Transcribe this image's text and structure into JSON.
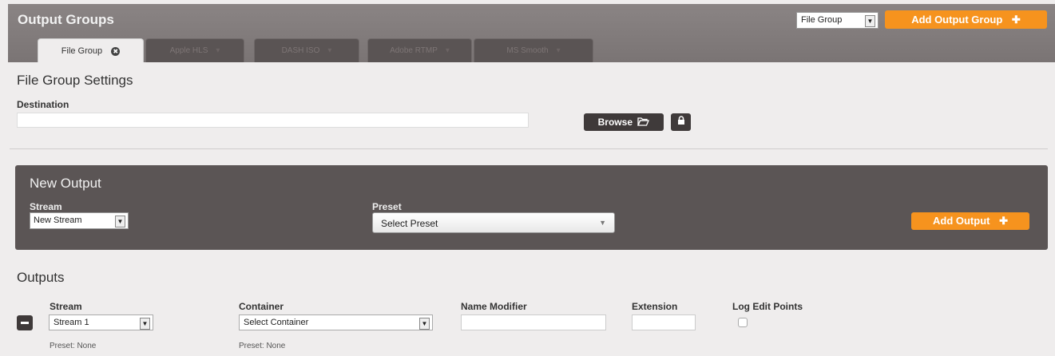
{
  "header": {
    "title": "Output Groups",
    "type_select": "File Group",
    "add_group_label": "Add Output Group",
    "add_group_icon": "✚"
  },
  "tabs": [
    {
      "label": "File Group",
      "active": true
    },
    {
      "label": "Apple HLS",
      "active": false
    },
    {
      "label": "DASH ISO",
      "active": false
    },
    {
      "label": "Adobe RTMP",
      "active": false
    },
    {
      "label": "MS Smooth",
      "active": false
    }
  ],
  "settings": {
    "title": "File Group Settings",
    "destination_label": "Destination",
    "destination_value": "",
    "browse_label": "Browse",
    "browse_icon": "folder-open-icon",
    "lock_icon": "lock-icon"
  },
  "new_output": {
    "title": "New Output",
    "stream_label": "Stream",
    "stream_value": "New Stream",
    "preset_label": "Preset",
    "preset_value": "Select Preset",
    "add_output_label": "Add Output",
    "add_output_icon": "✚"
  },
  "outputs": {
    "title": "Outputs",
    "columns": {
      "stream": "Stream",
      "container": "Container",
      "name_modifier": "Name Modifier",
      "extension": "Extension",
      "log_edit_points": "Log Edit Points"
    },
    "row": {
      "stream_value": "Stream 1",
      "container_value": "Select Container",
      "name_modifier_value": "",
      "extension_value": "",
      "stream_preset_note": "Preset: None",
      "container_preset_note": "Preset: None"
    }
  },
  "colors": {
    "accent": "#f6931e",
    "header_bg": "#817b7b",
    "panel_bg": "#5b5555",
    "button_dark": "#3f3a3a"
  }
}
